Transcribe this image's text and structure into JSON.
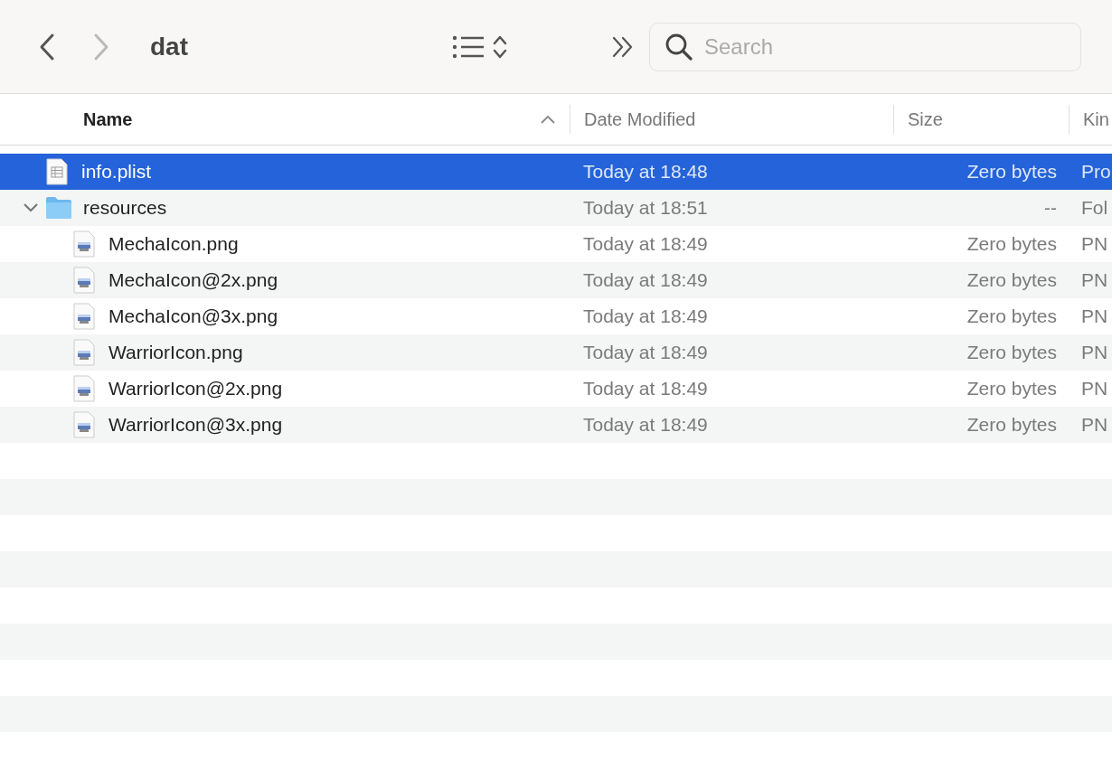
{
  "toolbar": {
    "back": {
      "disabled": false
    },
    "forward": {
      "disabled": true
    },
    "title": "dat",
    "search": {
      "placeholder": "Search"
    }
  },
  "columns": [
    {
      "label": "Name",
      "sorted": true,
      "bold": true
    },
    {
      "label": "Date Modified",
      "sorted": false,
      "bold": false
    },
    {
      "label": "Size",
      "sorted": false,
      "bold": false
    },
    {
      "label": "Kin",
      "sorted": false,
      "bold": false
    }
  ],
  "rows": [
    {
      "kind": "document",
      "name": "info.plist",
      "date": "Today at 18:48",
      "size": "Zero bytes",
      "type": "Pro",
      "selected": true
    },
    {
      "kind": "folder",
      "name": "resources",
      "date": "Today at 18:51",
      "size": "--",
      "type": "Fol",
      "selected": false,
      "expanded": true,
      "children": [
        {
          "kind": "image",
          "name": "MechaIcon.png",
          "date": "Today at 18:49",
          "size": "Zero bytes",
          "type": "PN",
          "selected": false
        },
        {
          "kind": "image",
          "name": "MechaIcon@2x.png",
          "date": "Today at 18:49",
          "size": "Zero bytes",
          "type": "PN",
          "selected": false
        },
        {
          "kind": "image",
          "name": "MechaIcon@3x.png",
          "date": "Today at 18:49",
          "size": "Zero bytes",
          "type": "PN",
          "selected": false
        },
        {
          "kind": "image",
          "name": "WarriorIcon.png",
          "date": "Today at 18:49",
          "size": "Zero bytes",
          "type": "PN",
          "selected": false
        },
        {
          "kind": "image",
          "name": "WarriorIcon@2x.png",
          "date": "Today at 18:49",
          "size": "Zero bytes",
          "type": "PN",
          "selected": false
        },
        {
          "kind": "image",
          "name": "WarriorIcon@3x.png",
          "date": "Today at 18:49",
          "size": "Zero bytes",
          "type": "PN",
          "selected": false
        }
      ]
    }
  ]
}
